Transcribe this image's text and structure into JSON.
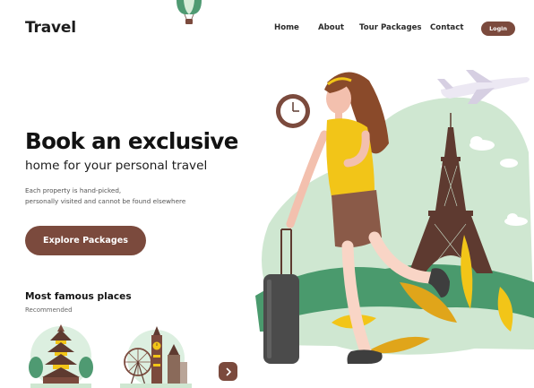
{
  "brand": {
    "name": "Travel"
  },
  "nav": {
    "items": [
      {
        "label": "Home"
      },
      {
        "label": "About"
      },
      {
        "label": "Tour Packages"
      },
      {
        "label": "Contact"
      }
    ],
    "login_label": "Login"
  },
  "hero": {
    "title": "Book an exclusive",
    "subtitle": "home for your personal travel",
    "description_lines": [
      "Each property is hand-picked,",
      "personally visited and cannot be found elsewhere"
    ],
    "cta_label": "Explore Packages"
  },
  "places": {
    "title": "Most famous places",
    "subtitle": "Recommended",
    "items": [
      {
        "icon": "pagoda-icon"
      },
      {
        "icon": "london-landmarks-icon"
      }
    ],
    "next_icon": "chevron-right-icon"
  },
  "colors": {
    "accent": "#7b4a3d",
    "green_light": "#cfe7d1",
    "green_dark": "#4a9a6d",
    "yellow": "#f2c518"
  }
}
